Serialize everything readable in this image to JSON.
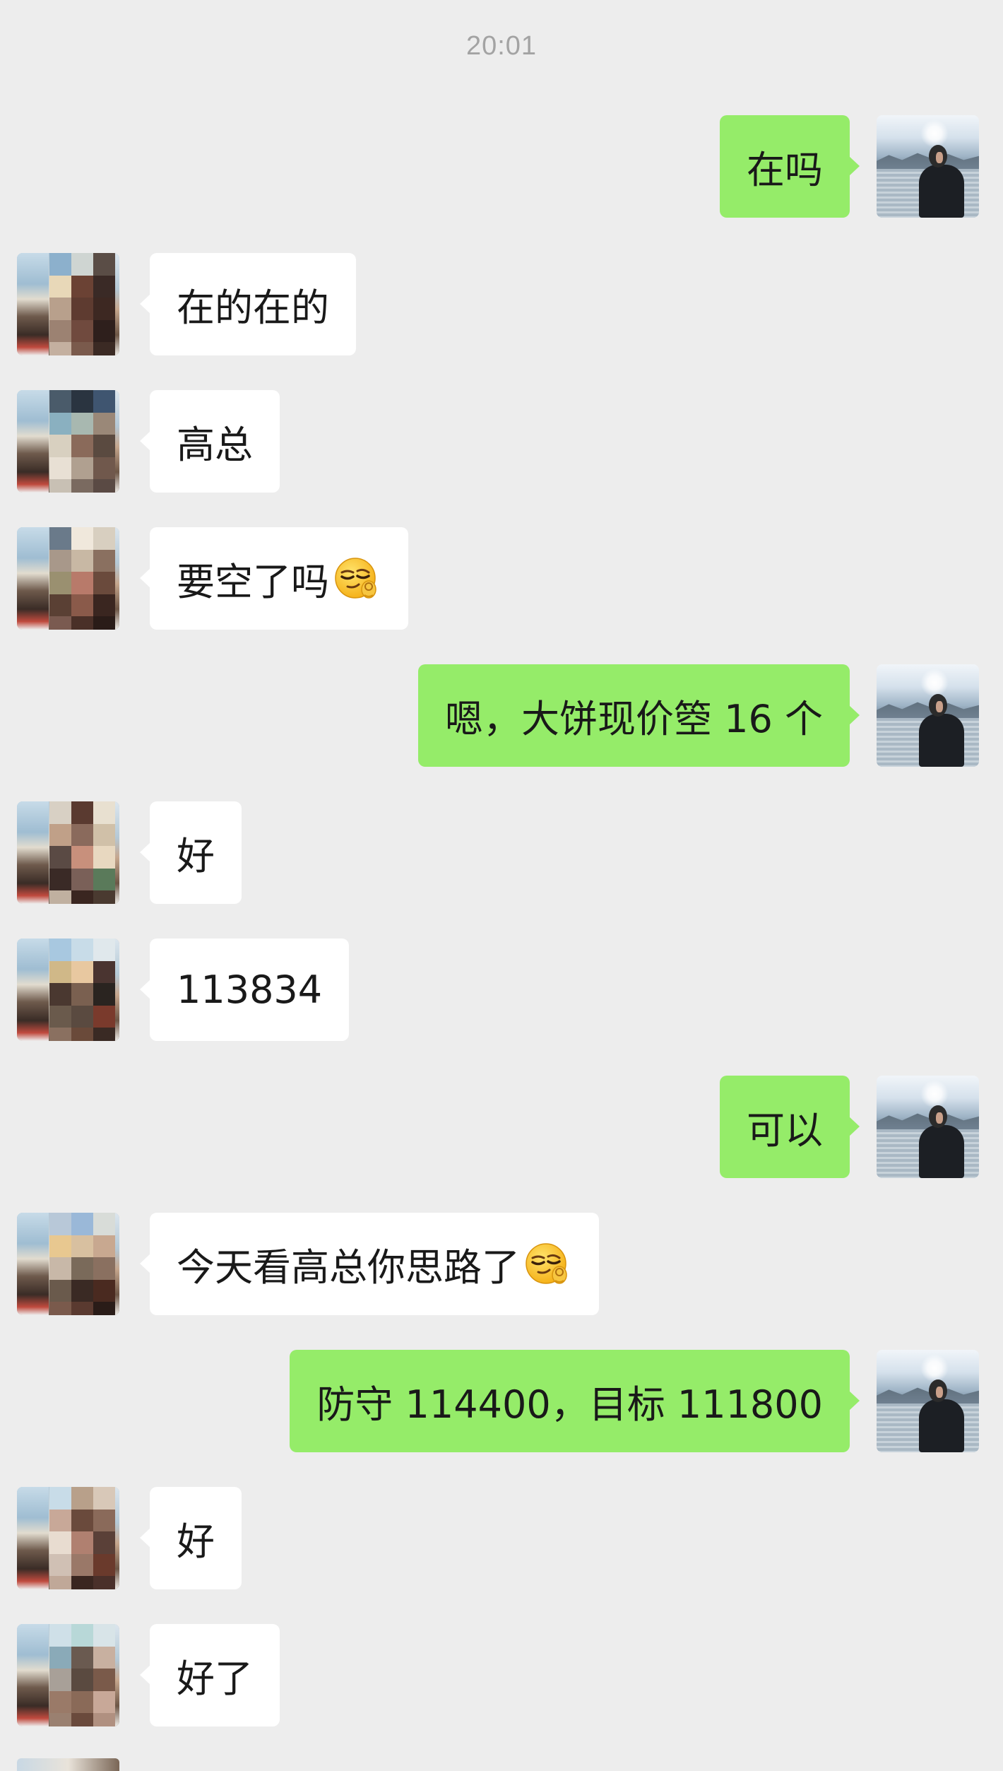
{
  "timestamp": "20:01",
  "colors": {
    "background": "#ededed",
    "self_bubble": "#95ec69",
    "other_bubble": "#ffffff",
    "text": "#191919",
    "timestamp": "#a3a3a3"
  },
  "messages": [
    {
      "side": "right",
      "text": "在吗",
      "avatar": "self-avatar"
    },
    {
      "side": "left",
      "text": "在的在的",
      "avatar": "contact-avatar"
    },
    {
      "side": "left",
      "text": "高总",
      "avatar": "contact-avatar"
    },
    {
      "side": "left",
      "text": "要空了吗",
      "emoji": "smirk-emoji",
      "avatar": "contact-avatar"
    },
    {
      "side": "right",
      "text": "嗯，大饼现价箜 16 个",
      "avatar": "self-avatar"
    },
    {
      "side": "left",
      "text": "好",
      "avatar": "contact-avatar"
    },
    {
      "side": "left",
      "text": "113834",
      "avatar": "contact-avatar"
    },
    {
      "side": "right",
      "text": "可以",
      "avatar": "self-avatar"
    },
    {
      "side": "left",
      "text": "今天看高总你思路了",
      "emoji": "smirk-emoji",
      "avatar": "contact-avatar"
    },
    {
      "side": "right",
      "text": "防守 114400，目标 111800",
      "avatar": "self-avatar"
    },
    {
      "side": "left",
      "text": "好",
      "avatar": "contact-avatar"
    },
    {
      "side": "left",
      "text": "好了",
      "avatar": "contact-avatar"
    }
  ]
}
